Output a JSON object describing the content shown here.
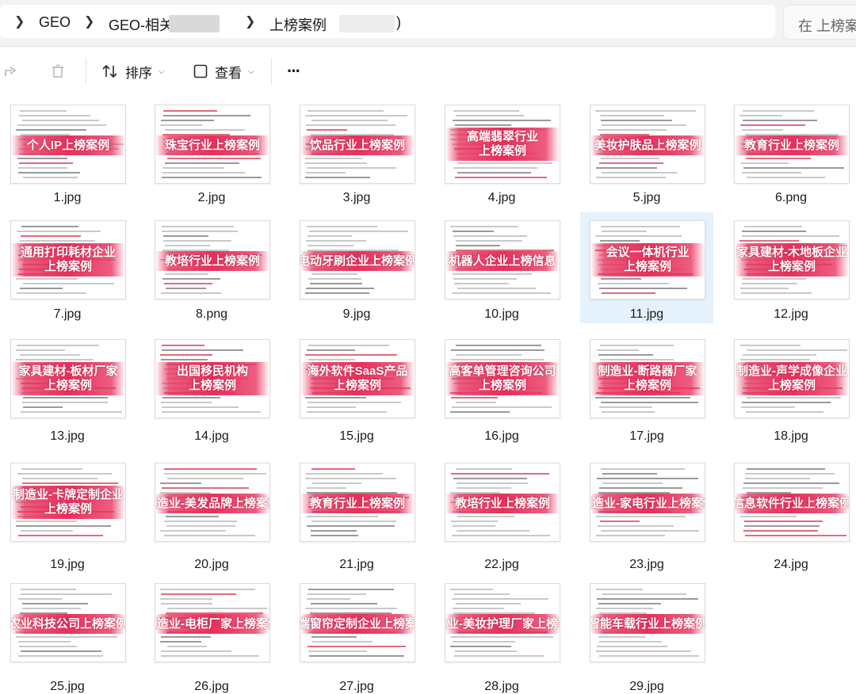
{
  "breadcrumb": {
    "items": [
      "GEO",
      "GEO-相关",
      "上榜案例",
      ")"
    ]
  },
  "search": {
    "placeholder": "在 上榜案"
  },
  "toolbar": {
    "sort_label": "排序",
    "view_label": "查看",
    "more_label": "···"
  },
  "files": [
    {
      "name": "1.jpg",
      "caption": [
        "个人IP上榜案例"
      ]
    },
    {
      "name": "2.jpg",
      "caption": [
        "珠宝行业上榜案例"
      ]
    },
    {
      "name": "3.jpg",
      "caption": [
        "饮品行业上榜案例"
      ]
    },
    {
      "name": "4.jpg",
      "caption": [
        "高端翡翠行业",
        "上榜案例"
      ]
    },
    {
      "name": "5.jpg",
      "caption": [
        "美妆护肤品上榜案例"
      ]
    },
    {
      "name": "6.png",
      "caption": [
        "教育行业上榜案例"
      ]
    },
    {
      "name": "7.jpg",
      "caption": [
        "通用打印耗材企业",
        "上榜案例"
      ]
    },
    {
      "name": "8.png",
      "caption": [
        "教培行业上榜案例"
      ]
    },
    {
      "name": "9.jpg",
      "caption": [
        "电动牙刷企业上榜案例"
      ]
    },
    {
      "name": "10.jpg",
      "caption": [
        "机器人企业上榜信息"
      ]
    },
    {
      "name": "11.jpg",
      "caption": [
        "会议一体机行业",
        "上榜案例"
      ]
    },
    {
      "name": "12.jpg",
      "caption": [
        "家具建材-木地板企业",
        "上榜案例"
      ]
    },
    {
      "name": "13.jpg",
      "caption": [
        "家具建材-板材厂家",
        "上榜案例"
      ]
    },
    {
      "name": "14.jpg",
      "caption": [
        "出国移民机构",
        "上榜案例"
      ]
    },
    {
      "name": "15.jpg",
      "caption": [
        "海外软件SaaS产品",
        "上榜案例"
      ]
    },
    {
      "name": "16.jpg",
      "caption": [
        "高客单管理咨询公司",
        "上榜案例"
      ]
    },
    {
      "name": "17.jpg",
      "caption": [
        "制造业-断路器厂家",
        "上榜案例"
      ]
    },
    {
      "name": "18.jpg",
      "caption": [
        "制造业-声学成像企业",
        "上榜案例"
      ]
    },
    {
      "name": "19.jpg",
      "caption": [
        "制造业-卡牌定制企业",
        "上榜案例"
      ]
    },
    {
      "name": "20.jpg",
      "caption": [
        "制造业-美发品牌上榜案例"
      ]
    },
    {
      "name": "21.jpg",
      "caption": [
        "教育行业上榜案例"
      ]
    },
    {
      "name": "22.jpg",
      "caption": [
        "教培行业上榜案例"
      ]
    },
    {
      "name": "23.jpg",
      "caption": [
        "制造业-家电行业上榜案例"
      ]
    },
    {
      "name": "24.jpg",
      "caption": [
        "信息软件行业上榜案例"
      ]
    },
    {
      "name": "25.jpg",
      "caption": [
        "农业科技公司上榜案例"
      ]
    },
    {
      "name": "26.jpg",
      "caption": [
        "制造业-电柜厂家上榜案例"
      ]
    },
    {
      "name": "27.jpg",
      "caption": [
        "高端窗帘定制企业上榜案例"
      ]
    },
    {
      "name": "28.jpg",
      "caption": [
        "零售业-美妆护理厂家上榜案例"
      ]
    },
    {
      "name": "29.jpg",
      "caption": [
        "智能车载行业上榜案例"
      ]
    }
  ],
  "selected_index": 10,
  "colors": {
    "banner": "#e8305c",
    "selection": "#e5f1fb",
    "addressbar": "#f3f3f3"
  }
}
